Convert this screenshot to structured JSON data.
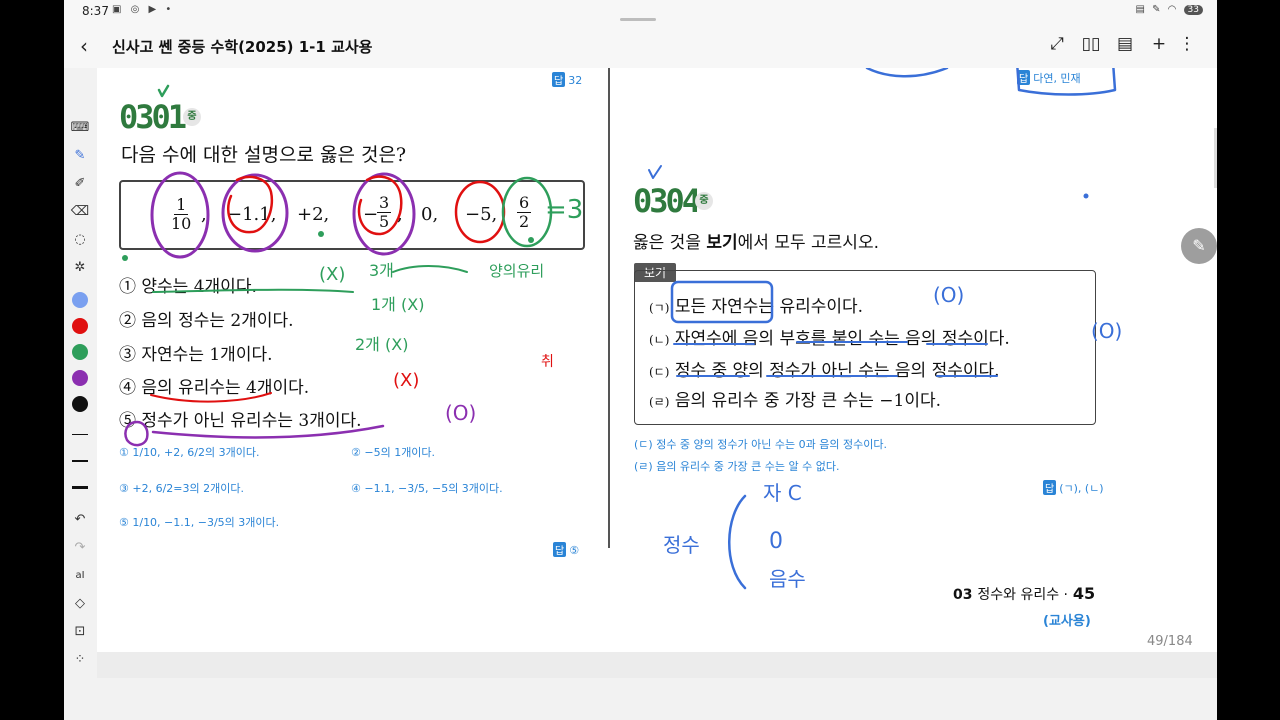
{
  "status_bar": {
    "time": "8:37",
    "battery": "33"
  },
  "app_bar": {
    "back_icon": "chevron-left-icon",
    "title": "신사고 쎈 중등 수학(2025) 1-1 교사용"
  },
  "toolbar_colors": [
    "#7aa0f0",
    "#e01010",
    "#2e9e5b",
    "#8b2fb0",
    "#111111"
  ],
  "left_page": {
    "ref_tag": "32",
    "problem_number": "0301",
    "difficulty": "중",
    "question": "다음 수에 대한 설명으로 옳은 것은?",
    "numbers": {
      "n1_num": "1",
      "n1_den": "10",
      "n2": "−1.1,",
      "n3": "+2,",
      "n4_sign": "−",
      "n4_num": "3",
      "n4_den": "5",
      "n5": "0,",
      "n6": "−5,",
      "n7_num": "6",
      "n7_den": "2",
      "sep1": ",",
      "sep2": ",",
      "sep3": ","
    },
    "options": [
      {
        "mark": "①",
        "text": "양수는 4개이다."
      },
      {
        "mark": "②",
        "text": "음의 정수는 2개이다."
      },
      {
        "mark": "③",
        "text": "자연수는 1개이다."
      },
      {
        "mark": "④",
        "text": "음의 유리수는 4개이다."
      },
      {
        "mark": "⑤",
        "text": "정수가 아닌 유리수는 3개이다."
      }
    ],
    "solutions": {
      "s1": "① 1/10, +2, 6/2의 3개이다.",
      "s2": "② −5의 1개이다.",
      "s3": "③ +2, 6/2=3의 2개이다.",
      "s4": "④ −1.1, −3/5, −5의 3개이다.",
      "s5": "⑤ 1/10, −1.1, −3/5의 3개이다."
    },
    "answer": "⑤"
  },
  "right_page": {
    "top_tag": "다연, 민재",
    "problem_number": "0304",
    "difficulty": "중",
    "question_prefix": "옳은 것을 ",
    "question_bold": "보기",
    "question_suffix": "에서 모두 고르시오.",
    "bogi_label": "보기",
    "bogi_items": [
      {
        "mark": "(ㄱ)",
        "text": "모든 자연수는 유리수이다."
      },
      {
        "mark": "(ㄴ)",
        "text": "자연수에 음의 부호를 붙인 수는 음의 정수이다."
      },
      {
        "mark": "(ㄷ)",
        "text": "정수 중 양의 정수가 아닌 수는 음의 정수이다."
      },
      {
        "mark": "(ㄹ)",
        "text": "음의 유리수 중 가장 큰 수는 −1이다."
      }
    ],
    "explanations": [
      "(ㄷ) 정수 중 양의 정수가 아닌 수는 0과 음의 정수이다.",
      "(ㄹ) 음의 유리수 중 가장 큰 수는 알 수 없다."
    ],
    "answer": "(ㄱ), (ㄴ)",
    "footer_chapter": "03",
    "footer_title": "정수와 유리수 ·",
    "footer_page": "45",
    "footer_tag": "(교사용)"
  },
  "annotations": {
    "green_1": "(X)",
    "green_2": "3개",
    "green_3": "양의유리",
    "green_4": "1개 (X)",
    "green_5": "2개 (X)",
    "green_6": "=3",
    "red_1": "(X)",
    "red_2": "취",
    "purple_1": "(O)",
    "blue_1": "(O)",
    "blue_2": "(O)",
    "blue_3": "정수",
    "blue_4": "자 C",
    "blue_5": "0",
    "blue_6": "음수"
  },
  "page_counter": "49/184"
}
